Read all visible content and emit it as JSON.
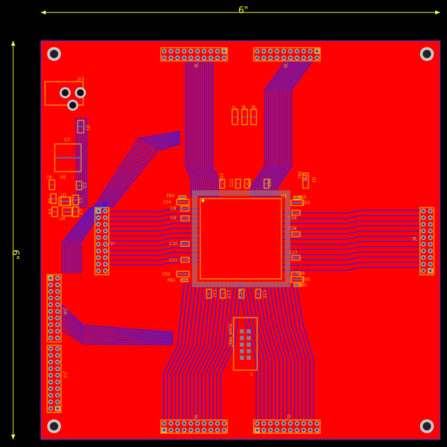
{
  "dimensions": {
    "width_label": "6\"",
    "height_label": "6\""
  },
  "colors": {
    "board": "#ff0000",
    "trace": "#2a1aff",
    "silkscreen": "#ffd700",
    "pad": "#a0a0b0",
    "dimension": "#ffff40"
  },
  "headers": {
    "J6": "J6",
    "J5": "J5",
    "J2": "J2",
    "J3": "J3",
    "J1": "J1",
    "J4": "J4",
    "J10": "J10",
    "J11": "J11"
  },
  "jtag": {
    "label": "JTAG_EPCS",
    "pin1": "1"
  },
  "fpga": {
    "label": "U1"
  },
  "power_jack": {
    "label": "J13"
  },
  "components": [
    "D1",
    "C7",
    "C6",
    "U5",
    "C5",
    "C2",
    "U3",
    "C1",
    "C4",
    "U4",
    "C3",
    "J7",
    "J8",
    "J9",
    "C23",
    "C22",
    "C21",
    "C20",
    "FB1",
    "Q1",
    "FB4",
    "C54",
    "C8",
    "C9",
    "C10",
    "C11",
    "C52",
    "FB2",
    "FB3",
    "C53",
    "C19",
    "C18",
    "C17",
    "C16",
    "C55",
    "FB5",
    "C12",
    "C13",
    "C14",
    "C15"
  ]
}
